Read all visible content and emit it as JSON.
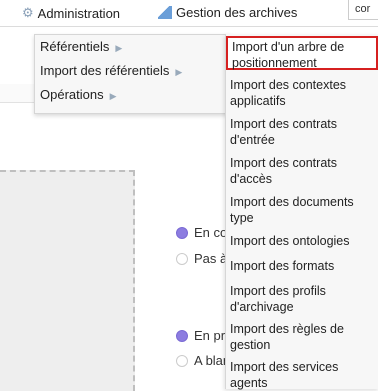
{
  "topbar": {
    "admin_label": "Administration",
    "gestion_label": "Gestion des archives",
    "topright_text": "cor"
  },
  "menu": {
    "items": [
      {
        "label": "Référentiels"
      },
      {
        "label": "Import des référentiels"
      },
      {
        "label": "Opérations"
      }
    ]
  },
  "submenu": {
    "items": [
      {
        "label": "Import d'un arbre de positionnement"
      },
      {
        "label": "Import des contextes applicatifs"
      },
      {
        "label": "Import des contrats d'entrée"
      },
      {
        "label": "Import des contrats d'accès"
      },
      {
        "label": "Import des documents type"
      },
      {
        "label": "Import des ontologies"
      },
      {
        "label": "Import des formats"
      },
      {
        "label": "Import des profils d'archivage"
      },
      {
        "label": "Import des règles de gestion"
      },
      {
        "label": "Import des services agents"
      }
    ]
  },
  "radios": {
    "group1_opt1": "En co",
    "group1_opt2": "Pas à",
    "group2_opt1": "En pr",
    "group2_opt2": "A blar"
  }
}
